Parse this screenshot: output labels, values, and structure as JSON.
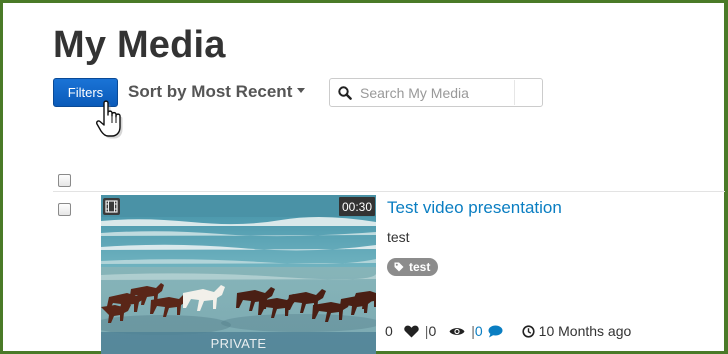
{
  "page": {
    "title": "My Media"
  },
  "toolbar": {
    "filters_label": "Filters",
    "sort_label": "Sort by Most Recent",
    "search_placeholder": "Search My Media",
    "search_value": ""
  },
  "entry": {
    "duration": "00:30",
    "privacy": "PRIVATE",
    "title": "Test video presentation",
    "description": "test",
    "tags": [
      "test"
    ],
    "likes": "0",
    "views": "0",
    "comments": "0",
    "date": "10 Months ago"
  },
  "colors": {
    "accent": "#0a7ec2",
    "filters_button": "#1a73d6",
    "frame_border": "#4a7a28",
    "tag_bg": "#8c8c8c"
  },
  "icons": [
    "search-icon",
    "film-icon",
    "tag-icon",
    "heart-icon",
    "eye-icon",
    "comment-icon",
    "clock-icon",
    "hand-cursor-icon"
  ]
}
